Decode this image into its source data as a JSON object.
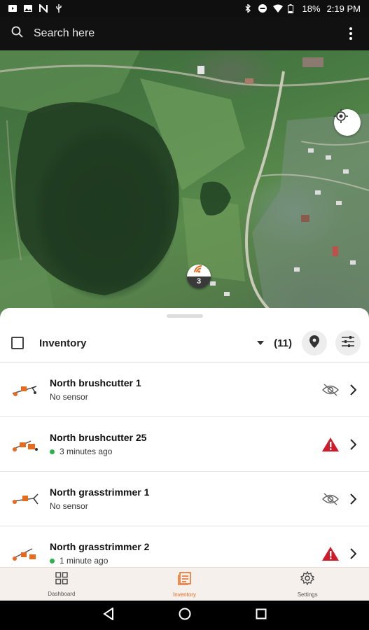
{
  "status_bar": {
    "battery": "18%",
    "time": "2:19 PM"
  },
  "search": {
    "placeholder": "Search here"
  },
  "map": {
    "cluster_count": "3"
  },
  "sheet": {
    "title": "Inventory",
    "count": "(11)"
  },
  "items": [
    {
      "name": "North brushcutter 1",
      "status_text": "No sensor",
      "online": false,
      "status_icon": "eye-off-icon"
    },
    {
      "name": "North brushcutter 25",
      "status_text": "3 minutes ago",
      "online": true,
      "status_icon": "warning-icon"
    },
    {
      "name": "North grasstrimmer 1",
      "status_text": "No sensor",
      "online": false,
      "status_icon": "eye-off-icon"
    },
    {
      "name": "North grasstrimmer 2",
      "status_text": "1 minute ago",
      "online": true,
      "status_icon": "warning-icon"
    }
  ],
  "bottom_nav": [
    {
      "label": "Dashboard",
      "icon": "grid-icon",
      "active": false
    },
    {
      "label": "Inventory",
      "icon": "inventory-icon",
      "active": true
    },
    {
      "label": "Settings",
      "icon": "gear-icon",
      "active": false
    }
  ],
  "colors": {
    "accent": "#e56b1f",
    "warning": "#d11a2a",
    "online": "#2bb24c"
  }
}
